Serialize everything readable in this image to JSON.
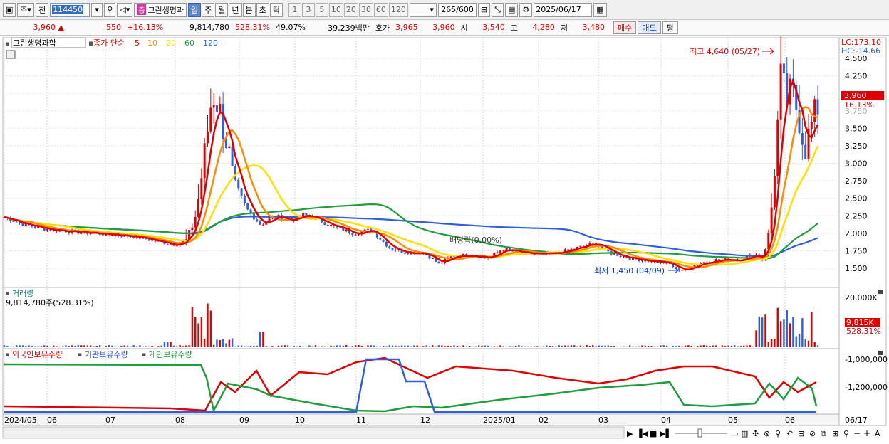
{
  "toolbar": {
    "market": "주",
    "prev": "전",
    "code": "114450",
    "zoom_icon": "magnifier-icon",
    "sound_icon": "speaker-icon",
    "stock_tag": "증",
    "stock_name": "그린생명과",
    "periods": [
      "일",
      "주",
      "월",
      "년",
      "분",
      "초",
      "틱"
    ],
    "active_period": "일",
    "intervals": [
      "1",
      "3",
      "5",
      "10",
      "20",
      "30",
      "60",
      "120"
    ],
    "count": "265",
    "count_total": "/600",
    "date": "2025/06/17"
  },
  "quote": {
    "price": "3,960",
    "direction": "▲",
    "change": "550",
    "change_pct": "+16.13%",
    "volume": "9,814,780",
    "volume_ratio": "528.31%",
    "turnover": "49.07%",
    "amount": "39,239백만",
    "hoga_label": "호가",
    "ask": "3,965",
    "bid": "3,960",
    "open_label": "시",
    "open": "3,540",
    "high_label": "고",
    "high": "4,280",
    "low_label": "저",
    "low": "3,480",
    "buy_label": "매수",
    "sell_label": "매도",
    "eval_label": "평"
  },
  "legend": {
    "name": "그린생명과학",
    "type": "종가 단순",
    "ma": [
      "5",
      "10",
      "20",
      "60",
      "120"
    ],
    "ma_colors": [
      "#e00000",
      "#ff8c00",
      "#ffe000",
      "#1e9e3c",
      "#2f5fe0"
    ]
  },
  "price_panel": {
    "lc": "LC:173.10",
    "hc": "HC:-14.66",
    "yticks": [
      "4,500",
      "4,250",
      "4,000",
      "3,750",
      "3,500",
      "3,250",
      "3,000",
      "2,750",
      "2,500",
      "2,250",
      "2,000",
      "1,750",
      "1,500"
    ],
    "current_price": "3,960",
    "current_pct": "16.13%",
    "high_note": "최고 4,640 (05/27)",
    "low_note": "최저 1,450 (04/09)",
    "drop_note": "배당락(0.00%)"
  },
  "volume_panel": {
    "title": "거래량",
    "value": "9,814,780주(528.31%)",
    "ytick": "20,000K",
    "current": "9,815K",
    "current_pct": "528.31%"
  },
  "holding_panel": {
    "labels": [
      "외국인보유수량",
      "기관보유수량",
      "개인보유수량"
    ],
    "colors": [
      "#e00000",
      "#2f5fe0",
      "#1e9e3c"
    ],
    "yticks": [
      "-1,000,000",
      "-1,200,000"
    ]
  },
  "xaxis": [
    "2024/05",
    "06",
    "07",
    "08",
    "09",
    "10",
    "11",
    "12",
    "2025/01",
    "02",
    "03",
    "04",
    "05",
    "06"
  ],
  "xaxis_last": "06/17",
  "chart_data": {
    "type": "candlestick",
    "x_range": [
      "2024/05",
      "2025/06/17"
    ],
    "ylim": [
      1350,
      4650
    ],
    "close_path": [
      {
        "x": "2024/05",
        "y": 2200
      },
      {
        "x": "06",
        "y": 2050
      },
      {
        "x": "07",
        "y": 1950
      },
      {
        "x": "08",
        "y": 1850
      },
      {
        "x": "08 mid",
        "y": 3800
      },
      {
        "x": "09",
        "y": 2150
      },
      {
        "x": "10",
        "y": 2250
      },
      {
        "x": "11",
        "y": 2000
      },
      {
        "x": "12",
        "y": 1550
      },
      {
        "x": "2025/01",
        "y": 1800
      },
      {
        "x": "02",
        "y": 1700
      },
      {
        "x": "03",
        "y": 1800
      },
      {
        "x": "04",
        "y": 1450
      },
      {
        "x": "05",
        "y": 1650
      },
      {
        "x": "05/27",
        "y": 4640
      },
      {
        "x": "06/17",
        "y": 3960
      }
    ]
  }
}
